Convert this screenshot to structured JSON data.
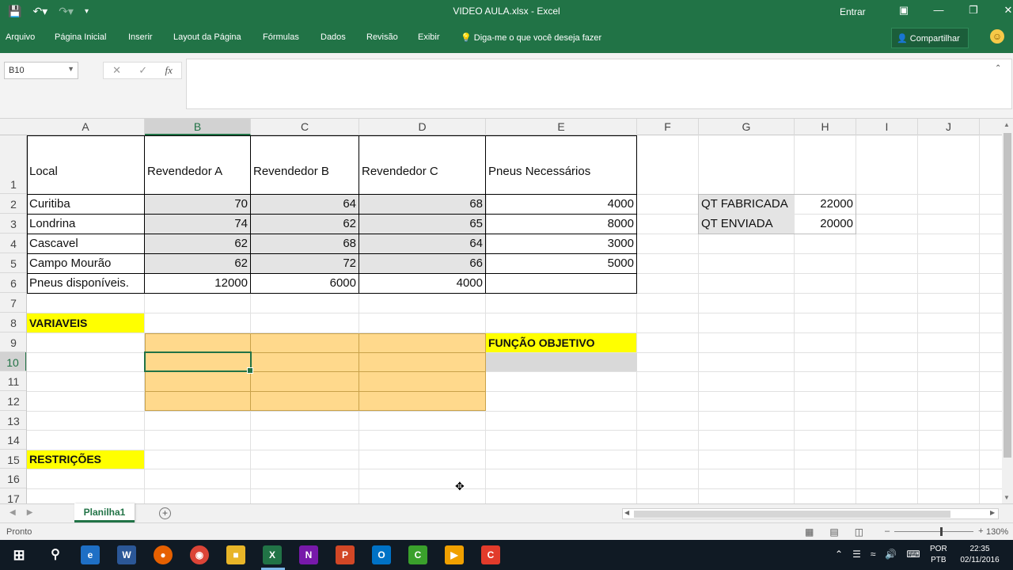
{
  "window": {
    "title": "VIDEO AULA.xlsx  -  Excel",
    "signin": "Entrar"
  },
  "ribbon": {
    "tabs": [
      "Arquivo",
      "Página Inicial",
      "Inserir",
      "Layout da Página",
      "Fórmulas",
      "Dados",
      "Revisão",
      "Exibir"
    ],
    "tell_me": "Diga-me o que você deseja fazer",
    "share": "Compartilhar"
  },
  "formula_bar": {
    "name_box": "B10",
    "content": ""
  },
  "columns": [
    "A",
    "B",
    "C",
    "D",
    "E",
    "F",
    "G",
    "H",
    "I",
    "J"
  ],
  "rows": [
    "1",
    "2",
    "3",
    "4",
    "5",
    "6",
    "7",
    "8",
    "9",
    "10",
    "11",
    "12",
    "13",
    "14",
    "15",
    "16",
    "17"
  ],
  "cells": {
    "A1": "Local",
    "B1": "Revendedor A",
    "C1": "Revendedor B",
    "D1": "Revendedor C",
    "E1": "Pneus Necessários",
    "A2": "Curitiba",
    "B2": "70",
    "C2": "64",
    "D2": "68",
    "E2": "4000",
    "A3": "Londrina",
    "B3": "74",
    "C3": "62",
    "D3": "65",
    "E3": "8000",
    "A4": "Cascavel",
    "B4": "62",
    "C4": "68",
    "D4": "64",
    "E4": "3000",
    "A5": "Campo Mourão",
    "B5": "62",
    "C5": "72",
    "D5": "66",
    "E5": "5000",
    "A6": "Pneus disponíveis.",
    "B6": "12000",
    "C6": "6000",
    "D6": "4000",
    "G2": "QT FABRICADA",
    "H2": "22000",
    "G3": "QT ENVIADA",
    "H3": "20000",
    "A8": "VARIAVEIS",
    "E9": "FUNÇÃO OBJETIVO",
    "A15": "RESTRIÇÕES"
  },
  "sheet_tabs": [
    "Planilha1"
  ],
  "status": {
    "ready": "Pronto",
    "zoom": "130%"
  },
  "taskbar": {
    "lang_1": "POR",
    "lang_2": "PTB",
    "time": "22:35",
    "date": "02/11/2016"
  },
  "colors": {
    "excel_green": "#217346",
    "yellow_fill": "#ffff00",
    "orange_fill": "#ffd98c",
    "gray_fill": "#e4e4e4"
  }
}
